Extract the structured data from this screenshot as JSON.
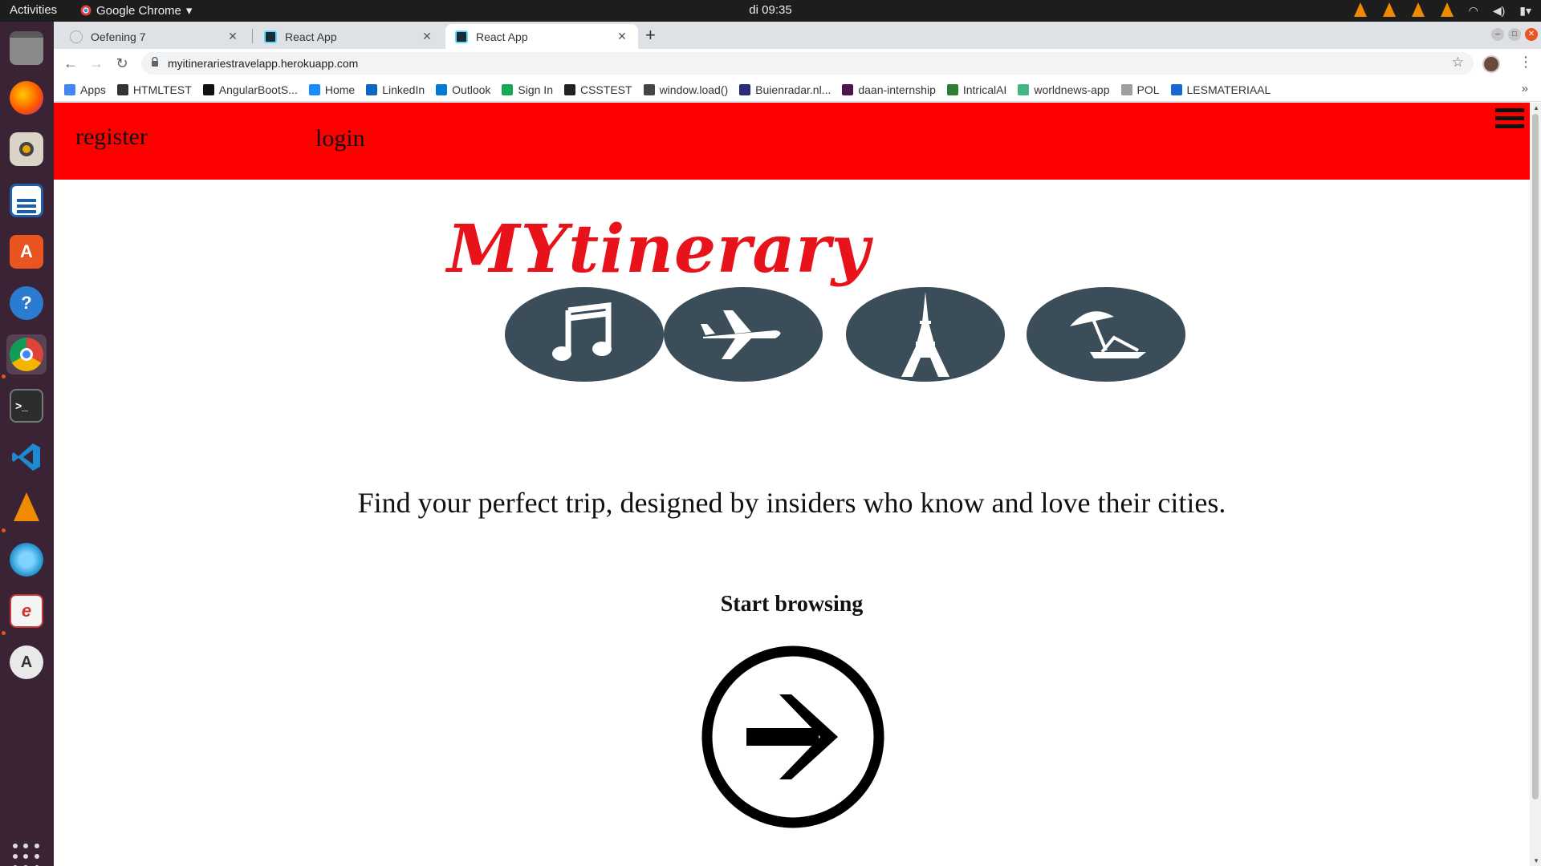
{
  "topbar": {
    "activities": "Activities",
    "app_name": "Google Chrome",
    "clock": "di 09:35"
  },
  "dock": {
    "items": [
      "files-icon",
      "firefox-icon",
      "rhythmbox-icon",
      "writer-icon",
      "software-icon",
      "help-icon",
      "chrome-icon",
      "terminal-icon",
      "vscode-icon",
      "vlc-icon",
      "gimp-icon",
      "ebook-icon",
      "updater-icon"
    ]
  },
  "tabs": [
    {
      "title": "Oefening 7"
    },
    {
      "title": "React App"
    },
    {
      "title": "React App"
    }
  ],
  "toolbar": {
    "url": "myitinerariestravelapp.herokuapp.com"
  },
  "bookmarks": [
    {
      "label": "Apps",
      "color": "#4285f4"
    },
    {
      "label": "HTMLTEST",
      "color": "#333333"
    },
    {
      "label": "AngularBootS...",
      "color": "#111111"
    },
    {
      "label": "Home",
      "color": "#1a8cff"
    },
    {
      "label": "LinkedIn",
      "color": "#0a66c2"
    },
    {
      "label": "Outlook",
      "color": "#0078d4"
    },
    {
      "label": "Sign In",
      "color": "#13aa52"
    },
    {
      "label": "CSSTEST",
      "color": "#222222"
    },
    {
      "label": "window.load()",
      "color": "#444444"
    },
    {
      "label": "Buienradar.nl...",
      "color": "#2b2a7a"
    },
    {
      "label": "daan-internship",
      "color": "#4a154b"
    },
    {
      "label": "IntricalAI",
      "color": "#2e7d32"
    },
    {
      "label": "worldnews-app",
      "color": "#41b883"
    },
    {
      "label": "POL",
      "color": "#9e9e9e"
    },
    {
      "label": "LESMATERIAAL",
      "color": "#1967d2"
    }
  ],
  "page": {
    "nav": {
      "register": "register",
      "login": "login"
    },
    "logo_text": "MYtinerary",
    "logo_icons": [
      "music-notes-icon",
      "airplane-icon",
      "eiffel-tower-icon",
      "beach-umbrella-icon"
    ],
    "tagline": "Find your perfect trip, designed by insiders who know and love their cities.",
    "start_browsing": "Start browsing",
    "accent_color": "#ff0000"
  }
}
